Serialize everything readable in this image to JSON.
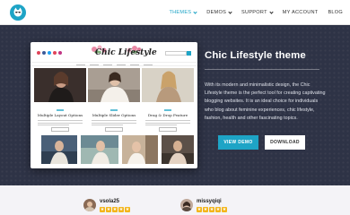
{
  "nav": {
    "logo_icon": "chic-cat-logo-icon",
    "items": [
      {
        "label": "THEMES",
        "has_dropdown": true,
        "active": true
      },
      {
        "label": "DEMOS",
        "has_dropdown": true,
        "active": false
      },
      {
        "label": "SUPPORT",
        "has_dropdown": true,
        "active": false
      },
      {
        "label": "MY ACCOUNT",
        "has_dropdown": false,
        "active": false
      },
      {
        "label": "BLOG",
        "has_dropdown": false,
        "active": false
      }
    ],
    "accent_color": "#1ea4c6"
  },
  "preview": {
    "site_logo": "Chic Lifestyle",
    "posts": [
      {
        "title": "Multiple Layout Options"
      },
      {
        "title": "Multiple Slider Options"
      },
      {
        "title": "Drag & Drop Feature"
      }
    ]
  },
  "hero": {
    "title": "Chic Lifestyle theme",
    "description": "With its modern and minimalistic design, the Chic Lifestyle theme is the perfect tool for creating captivating blogging websites. It is an ideal choice for individuals who blog about feminine experiences, chic lifestyle, fashion, health and other fascinating topics.",
    "view_demo_label": "VIEW DEMO",
    "download_label": "DOWNLOAD",
    "background_color": "#2e3346"
  },
  "reviews": [
    {
      "username": "vsola25",
      "rating": 5
    },
    {
      "username": "missyqiqi",
      "rating": 5
    }
  ],
  "star_color": "#f3b51a"
}
